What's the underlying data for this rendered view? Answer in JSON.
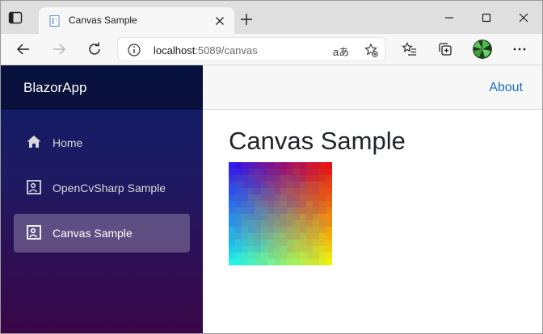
{
  "browser": {
    "tab": {
      "title": "Canvas Sample",
      "favicon": "page-icon"
    },
    "new_tab_icon": "plus-icon",
    "window_controls": [
      "minimize-icon",
      "maximize-icon",
      "close-icon"
    ],
    "address_bar": {
      "url_host": "localhost",
      "url_rest": ":5089/canvas",
      "info_icon": "info-icon",
      "read_aloud": "aあ",
      "favorite_icon": "star-plus-icon"
    },
    "toolbar_icons": [
      "back-icon",
      "forward-icon",
      "refresh-icon",
      "favorites-icon",
      "collections-icon",
      "profile-avatar",
      "more-icon"
    ]
  },
  "app": {
    "brand": "BlazorApp",
    "nav": [
      {
        "label": "Home",
        "icon": "home-icon",
        "active": false
      },
      {
        "label": "OpenCvSharp Sample",
        "icon": "image-frame-icon",
        "active": false
      },
      {
        "label": "Canvas Sample",
        "icon": "image-frame-icon",
        "active": true
      }
    ],
    "top_link": "About",
    "heading": "Canvas Sample",
    "canvas": {
      "content": "color gradient voronoi image",
      "colors": {
        "top_left": "#2a12f0",
        "top_right": "#f00a0a",
        "bottom_left": "#19f5f0",
        "bottom_right": "#f5f50a"
      }
    }
  },
  "colors": {
    "link": "#1b6ec2",
    "sidebar_top": "#0b1d63",
    "sidebar_bottom": "#3a0647"
  }
}
